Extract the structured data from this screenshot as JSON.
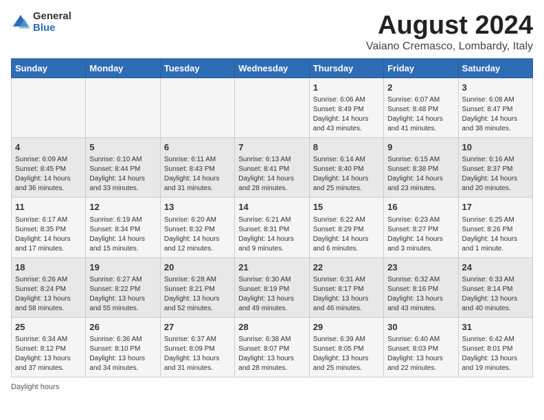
{
  "logo": {
    "general": "General",
    "blue": "Blue"
  },
  "title": "August 2024",
  "subtitle": "Vaiano Cremasco, Lombardy, Italy",
  "days_of_week": [
    "Sunday",
    "Monday",
    "Tuesday",
    "Wednesday",
    "Thursday",
    "Friday",
    "Saturday"
  ],
  "weeks": [
    [
      {
        "day": "",
        "info": ""
      },
      {
        "day": "",
        "info": ""
      },
      {
        "day": "",
        "info": ""
      },
      {
        "day": "",
        "info": ""
      },
      {
        "day": "1",
        "info": "Sunrise: 6:06 AM\nSunset: 8:49 PM\nDaylight: 14 hours and 43 minutes."
      },
      {
        "day": "2",
        "info": "Sunrise: 6:07 AM\nSunset: 8:48 PM\nDaylight: 14 hours and 41 minutes."
      },
      {
        "day": "3",
        "info": "Sunrise: 6:08 AM\nSunset: 8:47 PM\nDaylight: 14 hours and 38 minutes."
      }
    ],
    [
      {
        "day": "4",
        "info": "Sunrise: 6:09 AM\nSunset: 8:45 PM\nDaylight: 14 hours and 36 minutes."
      },
      {
        "day": "5",
        "info": "Sunrise: 6:10 AM\nSunset: 8:44 PM\nDaylight: 14 hours and 33 minutes."
      },
      {
        "day": "6",
        "info": "Sunrise: 6:11 AM\nSunset: 8:43 PM\nDaylight: 14 hours and 31 minutes."
      },
      {
        "day": "7",
        "info": "Sunrise: 6:13 AM\nSunset: 8:41 PM\nDaylight: 14 hours and 28 minutes."
      },
      {
        "day": "8",
        "info": "Sunrise: 6:14 AM\nSunset: 8:40 PM\nDaylight: 14 hours and 25 minutes."
      },
      {
        "day": "9",
        "info": "Sunrise: 6:15 AM\nSunset: 8:38 PM\nDaylight: 14 hours and 23 minutes."
      },
      {
        "day": "10",
        "info": "Sunrise: 6:16 AM\nSunset: 8:37 PM\nDaylight: 14 hours and 20 minutes."
      }
    ],
    [
      {
        "day": "11",
        "info": "Sunrise: 6:17 AM\nSunset: 8:35 PM\nDaylight: 14 hours and 17 minutes."
      },
      {
        "day": "12",
        "info": "Sunrise: 6:19 AM\nSunset: 8:34 PM\nDaylight: 14 hours and 15 minutes."
      },
      {
        "day": "13",
        "info": "Sunrise: 6:20 AM\nSunset: 8:32 PM\nDaylight: 14 hours and 12 minutes."
      },
      {
        "day": "14",
        "info": "Sunrise: 6:21 AM\nSunset: 8:31 PM\nDaylight: 14 hours and 9 minutes."
      },
      {
        "day": "15",
        "info": "Sunrise: 6:22 AM\nSunset: 8:29 PM\nDaylight: 14 hours and 6 minutes."
      },
      {
        "day": "16",
        "info": "Sunrise: 6:23 AM\nSunset: 8:27 PM\nDaylight: 14 hours and 3 minutes."
      },
      {
        "day": "17",
        "info": "Sunrise: 6:25 AM\nSunset: 8:26 PM\nDaylight: 14 hours and 1 minute."
      }
    ],
    [
      {
        "day": "18",
        "info": "Sunrise: 6:26 AM\nSunset: 8:24 PM\nDaylight: 13 hours and 58 minutes."
      },
      {
        "day": "19",
        "info": "Sunrise: 6:27 AM\nSunset: 8:22 PM\nDaylight: 13 hours and 55 minutes."
      },
      {
        "day": "20",
        "info": "Sunrise: 6:28 AM\nSunset: 8:21 PM\nDaylight: 13 hours and 52 minutes."
      },
      {
        "day": "21",
        "info": "Sunrise: 6:30 AM\nSunset: 8:19 PM\nDaylight: 13 hours and 49 minutes."
      },
      {
        "day": "22",
        "info": "Sunrise: 6:31 AM\nSunset: 8:17 PM\nDaylight: 13 hours and 46 minutes."
      },
      {
        "day": "23",
        "info": "Sunrise: 6:32 AM\nSunset: 8:16 PM\nDaylight: 13 hours and 43 minutes."
      },
      {
        "day": "24",
        "info": "Sunrise: 6:33 AM\nSunset: 8:14 PM\nDaylight: 13 hours and 40 minutes."
      }
    ],
    [
      {
        "day": "25",
        "info": "Sunrise: 6:34 AM\nSunset: 8:12 PM\nDaylight: 13 hours and 37 minutes."
      },
      {
        "day": "26",
        "info": "Sunrise: 6:36 AM\nSunset: 8:10 PM\nDaylight: 13 hours and 34 minutes."
      },
      {
        "day": "27",
        "info": "Sunrise: 6:37 AM\nSunset: 8:09 PM\nDaylight: 13 hours and 31 minutes."
      },
      {
        "day": "28",
        "info": "Sunrise: 6:38 AM\nSunset: 8:07 PM\nDaylight: 13 hours and 28 minutes."
      },
      {
        "day": "29",
        "info": "Sunrise: 6:39 AM\nSunset: 8:05 PM\nDaylight: 13 hours and 25 minutes."
      },
      {
        "day": "30",
        "info": "Sunrise: 6:40 AM\nSunset: 8:03 PM\nDaylight: 13 hours and 22 minutes."
      },
      {
        "day": "31",
        "info": "Sunrise: 6:42 AM\nSunset: 8:01 PM\nDaylight: 13 hours and 19 minutes."
      }
    ]
  ],
  "footer": "Daylight hours"
}
